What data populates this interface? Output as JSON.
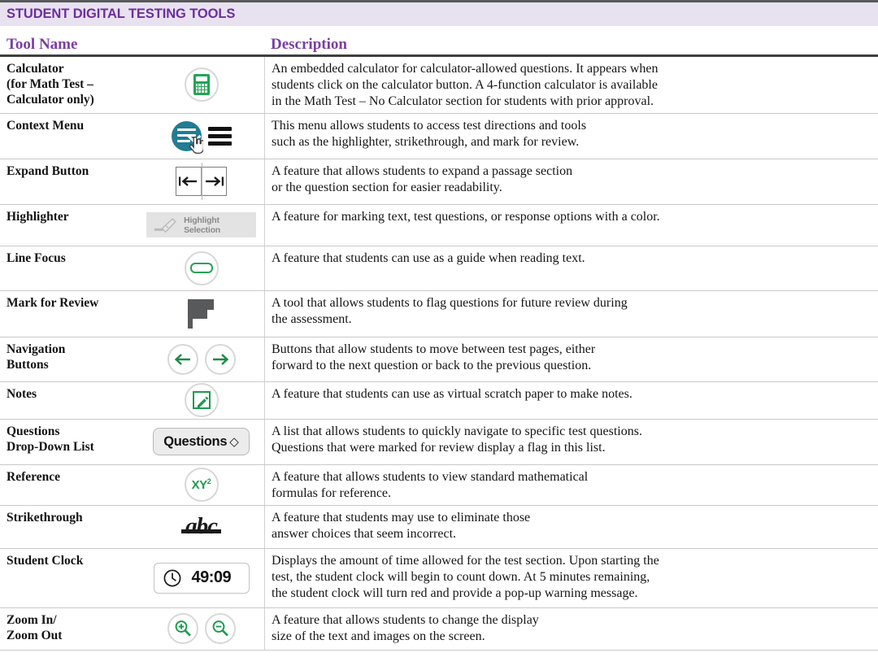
{
  "banner": {
    "title": "STUDENT DIGITAL TESTING TOOLS",
    "background_color": "#e8e1ef",
    "text_color": "#6b2f9e"
  },
  "columns": {
    "name": "Tool Name",
    "description": "Description",
    "header_color": "#7b3fa0"
  },
  "accent_colors": {
    "green": "#1d9a4e",
    "teal": "#217c94",
    "gray": "#58595b",
    "purple": "#6b2f9e"
  },
  "rows": [
    {
      "name": "Calculator\n(for Math Test –\nCalculator only)",
      "name_lines": [
        "Calculator",
        "(for Math Test –",
        "Calculator only)"
      ],
      "icon": "calculator-icon",
      "description_lines": [
        "An embedded calculator for calculator-allowed questions. It appears when",
        "students click on the calculator button. A 4-function calculator is available",
        "in the Math Test – No Calculator section for students with prior approval."
      ]
    },
    {
      "name": "Context Menu",
      "name_lines": [
        "Context Menu"
      ],
      "icon": "context-menu-icon",
      "description_lines": [
        "This menu allows students to access test directions and tools",
        "such as the highlighter, strikethrough, and mark for review."
      ]
    },
    {
      "name": "Expand Button",
      "name_lines": [
        "Expand Button"
      ],
      "icon": "expand-button-icon",
      "description_lines": [
        "A feature that allows students to expand a passage section",
        "or the question section for easier readability."
      ]
    },
    {
      "name": "Highlighter",
      "name_lines": [
        "Highlighter"
      ],
      "icon": "highlighter-icon",
      "icon_label": "Highlight Selection",
      "description_lines": [
        "A feature for marking text, test questions, or response options with a color."
      ]
    },
    {
      "name": "Line Focus",
      "name_lines": [
        "Line Focus"
      ],
      "icon": "line-focus-icon",
      "description_lines": [
        "A feature that students can use as a guide when reading text."
      ]
    },
    {
      "name": "Mark for Review",
      "name_lines": [
        "Mark for Review"
      ],
      "icon": "flag-icon",
      "description_lines": [
        "A tool that allows students to flag questions for future review during",
        "the assessment."
      ]
    },
    {
      "name": "Navigation Buttons",
      "name_lines": [
        "Navigation",
        "Buttons"
      ],
      "icon": "navigation-arrows-icon",
      "description_lines": [
        "Buttons that allow students to move between test pages, either",
        "forward to the next question or back to the previous question."
      ]
    },
    {
      "name": "Notes",
      "name_lines": [
        "Notes"
      ],
      "icon": "notes-icon",
      "description_lines": [
        "A feature that students can use as virtual scratch paper to make notes."
      ]
    },
    {
      "name": "Questions Drop-Down List",
      "name_lines": [
        "Questions",
        "Drop-Down List"
      ],
      "icon": "questions-dropdown-icon",
      "icon_label": "Questions",
      "description_lines": [
        "A list that allows students to quickly navigate to specific test questions.",
        "Questions that were marked for review display a flag in this list."
      ]
    },
    {
      "name": "Reference",
      "name_lines": [
        "Reference"
      ],
      "icon": "reference-icon",
      "icon_label": "XY2",
      "description_lines": [
        "A feature that allows students to view standard mathematical",
        "formulas for reference."
      ]
    },
    {
      "name": "Strikethrough",
      "name_lines": [
        "Strikethrough"
      ],
      "icon": "strikethrough-icon",
      "icon_label": "abc",
      "description_lines": [
        "A feature that students may use to eliminate those",
        "answer choices that seem incorrect."
      ]
    },
    {
      "name": "Student Clock",
      "name_lines": [
        "Student Clock"
      ],
      "icon": "clock-icon",
      "icon_label": "49:09",
      "description_lines": [
        "Displays the amount of time allowed for the test section. Upon starting the",
        "test, the student clock will begin to count down. At 5 minutes remaining,",
        "the student clock will turn red and provide a pop-up warning message."
      ]
    },
    {
      "name": "Zoom In/ Zoom Out",
      "name_lines": [
        "Zoom In/",
        "Zoom Out"
      ],
      "icon": "zoom-in-out-icon",
      "description_lines": [
        "A feature that allows students to change the display",
        "size of the text and images on the screen."
      ]
    }
  ]
}
